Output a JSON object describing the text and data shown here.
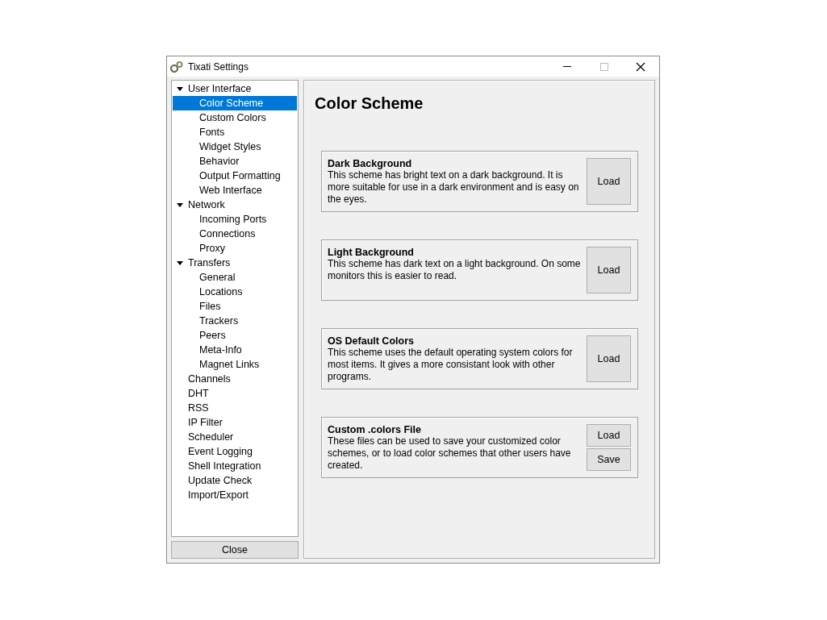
{
  "window": {
    "title": "Tixati Settings"
  },
  "tree": [
    {
      "label": "User Interface",
      "selected": false,
      "expanded": true,
      "children": [
        {
          "label": "Color Scheme",
          "selected": true
        },
        {
          "label": "Custom Colors",
          "selected": false
        },
        {
          "label": "Fonts",
          "selected": false
        },
        {
          "label": "Widget Styles",
          "selected": false
        },
        {
          "label": "Behavior",
          "selected": false
        },
        {
          "label": "Output Formatting",
          "selected": false
        },
        {
          "label": "Web Interface",
          "selected": false
        }
      ]
    },
    {
      "label": "Network",
      "selected": false,
      "expanded": true,
      "children": [
        {
          "label": "Incoming Ports",
          "selected": false
        },
        {
          "label": "Connections",
          "selected": false
        },
        {
          "label": "Proxy",
          "selected": false
        }
      ]
    },
    {
      "label": "Transfers",
      "selected": false,
      "expanded": true,
      "children": [
        {
          "label": "General",
          "selected": false
        },
        {
          "label": "Locations",
          "selected": false
        },
        {
          "label": "Files",
          "selected": false
        },
        {
          "label": "Trackers",
          "selected": false
        },
        {
          "label": "Peers",
          "selected": false
        },
        {
          "label": "Meta-Info",
          "selected": false
        },
        {
          "label": "Magnet Links",
          "selected": false
        }
      ]
    },
    {
      "label": "Channels",
      "selected": false
    },
    {
      "label": "DHT",
      "selected": false
    },
    {
      "label": "RSS",
      "selected": false
    },
    {
      "label": "IP Filter",
      "selected": false
    },
    {
      "label": "Scheduler",
      "selected": false
    },
    {
      "label": "Event Logging",
      "selected": false
    },
    {
      "label": "Shell Integration",
      "selected": false
    },
    {
      "label": "Update Check",
      "selected": false
    },
    {
      "label": "Import/Export",
      "selected": false
    }
  ],
  "close_button": "Close",
  "panel": {
    "title": "Color Scheme",
    "schemes": [
      {
        "title": "Dark Background",
        "description": "This scheme has bright text on a dark background.  It is more suitable for use in a dark environment and is easy on the eyes.",
        "buttons": [
          "Load"
        ]
      },
      {
        "title": "Light Background",
        "description": "This scheme has dark text on a light background.  On some monitors this is easier to read.",
        "buttons": [
          "Load"
        ]
      },
      {
        "title": "OS Default Colors",
        "description": "This scheme uses the default operating system colors for most items.  It gives a more consistant look with other programs.",
        "buttons": [
          "Load"
        ]
      },
      {
        "title": "Custom .colors File",
        "description": "These files can be used to save your customized color schemes, or to load color schemes that other users have created.",
        "buttons": [
          "Load",
          "Save"
        ]
      }
    ]
  }
}
